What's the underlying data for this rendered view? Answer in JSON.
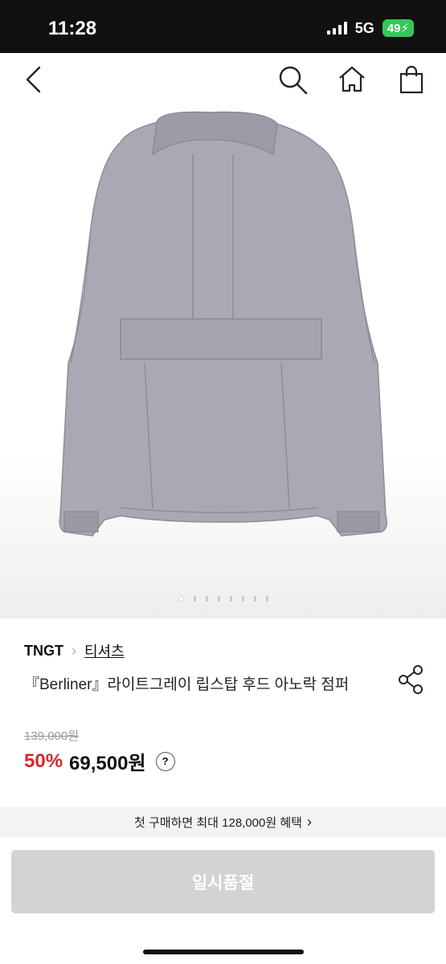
{
  "status": {
    "time": "11:28",
    "network": "5G",
    "battery": "49"
  },
  "nav": {
    "back_icon": "back-icon",
    "search_icon": "search-icon",
    "home_icon": "home-icon",
    "cart_icon": "shopping-bag-icon"
  },
  "product": {
    "brand": "TNGT",
    "category": "티셔츠",
    "title": "『Berliner』라이트그레이 립스탑 후드 아노락 점퍼",
    "original_price": "139,000원",
    "discount": "50%",
    "price": "69,500원",
    "help": "?",
    "image_color": "#a8a8b2",
    "image_index": 1,
    "image_count": 8
  },
  "benefit": {
    "text": "첫 구매하면 최대 128,000원 혜택",
    "chevron": "›"
  },
  "cta": {
    "label": "일시품절"
  },
  "colors": {
    "discount": "#d9262f",
    "cta_bg": "#d3d3d3"
  }
}
